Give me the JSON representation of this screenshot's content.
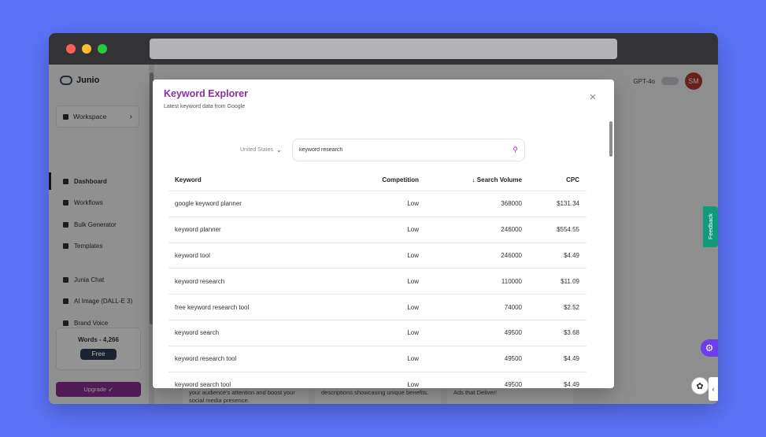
{
  "app": {
    "brand": "Junio",
    "workspace_label": "Workspace",
    "nav": [
      {
        "label": "Dashboard"
      },
      {
        "label": "Workflows"
      },
      {
        "label": "Bulk Generator"
      },
      {
        "label": "Templates"
      },
      {
        "label": "Junia Chat"
      },
      {
        "label": "AI Image (DALL-E 3)"
      },
      {
        "label": "Brand Voice"
      }
    ],
    "words_label": "Words - 4,266",
    "plan_badge": "Free",
    "upgrade_label": "Upgrade",
    "model_label": "GPT-4o",
    "avatar_initials": "SM",
    "feedback_label": "Feedback",
    "bg_cards": [
      "your audience's attention and boost your social media presence.",
      "descriptions showcasing unique benefits.",
      "Ads that Deliver!"
    ]
  },
  "modal": {
    "title": "Keyword Explorer",
    "subtitle": "Latest keyword data from Google",
    "country": "United States",
    "search_value": "keyword research",
    "columns": {
      "keyword": "Keyword",
      "competition": "Competition",
      "volume": "Search Volume",
      "cpc": "CPC"
    },
    "rows": [
      {
        "keyword": "google keyword planner",
        "competition": "Low",
        "volume": "368000",
        "cpc": "$131.34"
      },
      {
        "keyword": "keyword planner",
        "competition": "Low",
        "volume": "246000",
        "cpc": "$554.55"
      },
      {
        "keyword": "keyword tool",
        "competition": "Low",
        "volume": "246000",
        "cpc": "$4.49"
      },
      {
        "keyword": "keyword research",
        "competition": "Low",
        "volume": "110000",
        "cpc": "$11.09"
      },
      {
        "keyword": "free keyword research tool",
        "competition": "Low",
        "volume": "74000",
        "cpc": "$2.52"
      },
      {
        "keyword": "keyword search",
        "competition": "Low",
        "volume": "49500",
        "cpc": "$3.68"
      },
      {
        "keyword": "keyword research tool",
        "competition": "Low",
        "volume": "49500",
        "cpc": "$4.49"
      },
      {
        "keyword": "keyword search tool",
        "competition": "Low",
        "volume": "49500",
        "cpc": "$4.49"
      }
    ]
  },
  "icons": {
    "sort": "arrow-down-icon",
    "search": "search-icon",
    "close": "close-icon"
  },
  "colors": {
    "accent": "#8e2ea3",
    "background": "#5b73f8"
  }
}
